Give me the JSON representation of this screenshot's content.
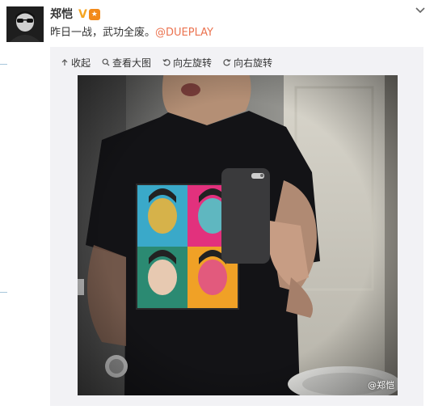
{
  "post": {
    "username": "郑恺",
    "verified_badge": "V",
    "medal_icon": "medal-icon",
    "text": "昨日一战，武功全废。",
    "mention": "@DUEPLAY"
  },
  "media_toolbar": {
    "collapse_label": "收起",
    "view_large_label": "查看大图",
    "rotate_left_label": "向左旋转",
    "rotate_right_label": "向右旋转"
  },
  "photo": {
    "description_icon": "mirror-selfie-photo",
    "watermark": "@郑恺"
  },
  "colors": {
    "mention": "#eb7350",
    "verified": "#f5a623",
    "panel_bg": "#f2f2f5"
  }
}
